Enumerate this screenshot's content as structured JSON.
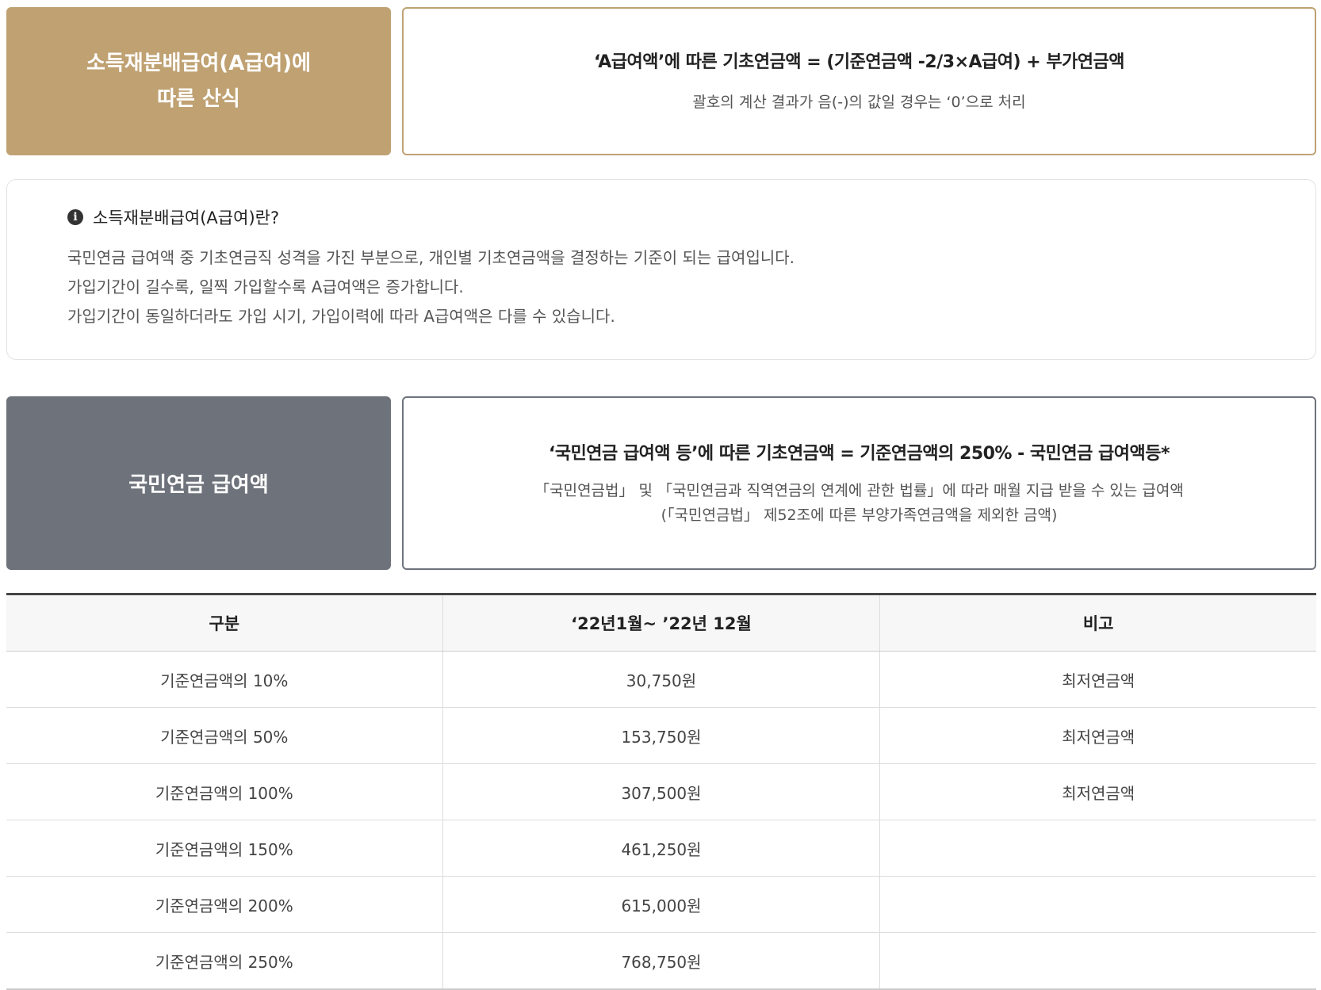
{
  "section_a": {
    "tag_line1": "소득재분배급여(A급여)에",
    "tag_line2": "따른 산식",
    "formula": "‘A급여액’에 따른 기초연금액 = (기준연금액 -2/3×A급여) + 부가연금액",
    "note": "괄호의 계산 결과가 음(-)의 값일 경우는 ‘0’으로 처리"
  },
  "info": {
    "title": "소득재분배급여(A급여)란?",
    "lines": [
      "국민연금 급여액 중 기초연금직 성격을 가진 부분으로, 개인별 기초연금액을 결정하는 기준이 되는 급여입니다.",
      "가입기간이 길수록, 일찍 가입할수록 A급여액은 증가합니다.",
      "가입기간이 동일하더라도 가입 시기, 가입이력에 따라 A급여액은 다를 수 있습니다."
    ]
  },
  "section_b": {
    "tag": "국민연금 급여액",
    "formula": "‘국민연금 급여액 등’에 따른 기초연금액 = 기준연금액의 250% - 국민연금 급여액등*",
    "note_line1": "「국민연금법」 및 「국민연금과 직역연금의 연계에 관한 법률」에 따라 매월 지급 받을 수 있는 급여액",
    "note_line2": "(「국민연금법」 제52조에 따른 부양가족연금액을 제외한 금액)"
  },
  "table": {
    "headers": [
      "구분",
      "‘22년1월~ ’22년 12월",
      "비고"
    ],
    "rows": [
      [
        "기준연금액의 10%",
        "30,750원",
        "최저연금액"
      ],
      [
        "기준연금액의 50%",
        "153,750원",
        "최저연금액"
      ],
      [
        "기준연금액의 100%",
        "307,500원",
        "최저연금액"
      ],
      [
        "기준연금액의 150%",
        "461,250원",
        ""
      ],
      [
        "기준연금액의 200%",
        "615,000원",
        ""
      ],
      [
        "기준연금액의 250%",
        "768,750원",
        ""
      ]
    ]
  }
}
